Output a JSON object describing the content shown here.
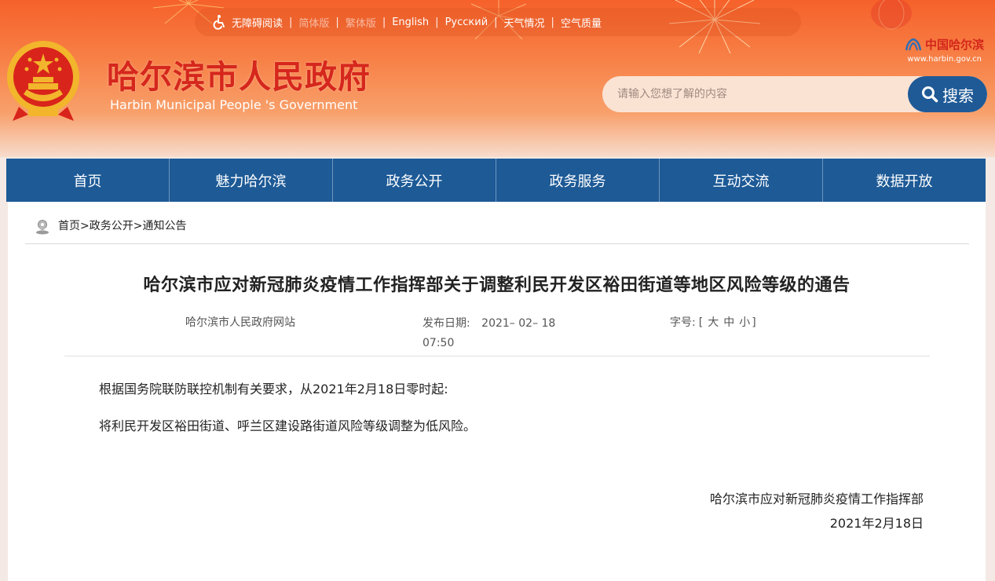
{
  "topbar": {
    "accessibility": "无障碍阅读",
    "simplified": "简体版",
    "traditional": "繁体版",
    "english": "English",
    "russian": "Русский",
    "weather": "天气情况",
    "air_quality": "空气质量",
    "separator": "|"
  },
  "brand": {
    "title": "哈尔滨市人民政府",
    "subtitle": "Harbin Municipal People 's Government",
    "logo_text": "中国哈尔滨",
    "logo_url": "www.harbin.gov.cn"
  },
  "search": {
    "placeholder": "请输入您想了解的内容",
    "button": "搜索"
  },
  "nav": {
    "items": [
      "首页",
      "魅力哈尔滨",
      "政务公开",
      "政务服务",
      "互动交流",
      "数据开放"
    ]
  },
  "breadcrumb": "首页>政务公开>通知公告",
  "article": {
    "title": "哈尔滨市应对新冠肺炎疫情工作指挥部关于调整利民开发区裕田街道等地区风险等级的通告",
    "source": "哈尔滨市人民政府网站",
    "date_label": "发布日期:",
    "date_value": "2021– 02– 18",
    "time_value": "07:50",
    "fontsize_label": "字号:",
    "fontsize_open": "[",
    "fontsize_large": "大",
    "fontsize_medium": "中",
    "fontsize_small": "小",
    "fontsize_close": "]",
    "paragraph1": "根据国务院联防联控机制有关要求，从2021年2月18日零时起:",
    "paragraph2": "将利民开发区裕田街道、呼兰区建设路街道风险等级调整为低风险。",
    "signature_org": "哈尔滨市应对新冠肺炎疫情工作指挥部",
    "signature_date": "2021年2月18日"
  },
  "colors": {
    "nav_bg": "#1d5a96",
    "title_red": "#d6271c",
    "header_orange": "#f6612a"
  }
}
